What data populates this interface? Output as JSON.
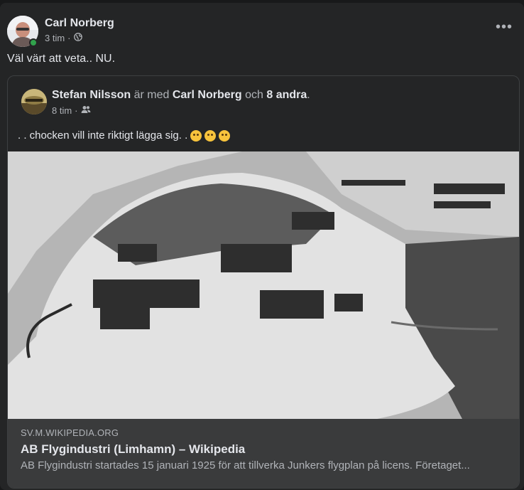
{
  "post": {
    "author": "Carl Norberg",
    "time": "3 tim",
    "separator": "·",
    "privacy_icon": "globe-icon",
    "text": "Väl värt att veta.. NU.",
    "more_label": "•••"
  },
  "shared": {
    "author": "Stefan Nilsson",
    "with_text": "är med",
    "tagged": "Carl Norberg",
    "and_text": "och",
    "others": "8 andra",
    "period": ".",
    "time": "8 tim",
    "separator": "·",
    "audience_icon": "friends-icon",
    "text": ". . chocken vill inte riktigt lägga sig. .",
    "emojis": [
      "thinking-face-emoji",
      "upside-down-face-emoji",
      "grinning-squinting-face-emoji"
    ]
  },
  "link": {
    "domain": "SV.M.WIKIPEDIA.ORG",
    "title": "AB Flygindustri (Limhamn) – Wikipedia",
    "description": "AB Flygindustri startades 15 januari 1925 för att tillverka Junkers flygplan på licens. Företaget..."
  },
  "colors": {
    "background": "#18191a",
    "card": "#242526",
    "link_box": "#3a3b3c",
    "online": "#31a24c"
  }
}
